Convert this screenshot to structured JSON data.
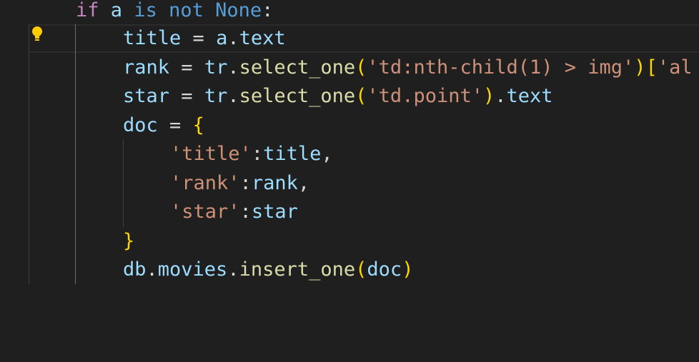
{
  "editor": {
    "language": "python",
    "theme_background": "#1f1f1f",
    "active_line": 2,
    "lightbulb_icon": "lightbulb-icon"
  },
  "lines": [
    {
      "tokens": [
        {
          "t": "if",
          "c": "kw"
        },
        {
          "t": " ",
          "c": "op"
        },
        {
          "t": "a",
          "c": "var"
        },
        {
          "t": " ",
          "c": "op"
        },
        {
          "t": "is",
          "c": "kwb"
        },
        {
          "t": " ",
          "c": "op"
        },
        {
          "t": "not",
          "c": "kwb"
        },
        {
          "t": " ",
          "c": "op"
        },
        {
          "t": "None",
          "c": "cst"
        },
        {
          "t": ":",
          "c": "op"
        }
      ]
    },
    {
      "tokens": [
        {
          "t": "title",
          "c": "var"
        },
        {
          "t": " = ",
          "c": "op"
        },
        {
          "t": "a",
          "c": "var"
        },
        {
          "t": ".",
          "c": "op"
        },
        {
          "t": "text",
          "c": "var"
        }
      ]
    },
    {
      "tokens": [
        {
          "t": "rank",
          "c": "var"
        },
        {
          "t": " = ",
          "c": "op"
        },
        {
          "t": "tr",
          "c": "var"
        },
        {
          "t": ".",
          "c": "op"
        },
        {
          "t": "select_one",
          "c": "fn"
        },
        {
          "t": "(",
          "c": "br1"
        },
        {
          "t": "'td:nth-child(1) > img'",
          "c": "str"
        },
        {
          "t": ")",
          "c": "br1"
        },
        {
          "t": "[",
          "c": "br1"
        },
        {
          "t": "'al",
          "c": "str"
        }
      ]
    },
    {
      "tokens": [
        {
          "t": "star",
          "c": "var"
        },
        {
          "t": " = ",
          "c": "op"
        },
        {
          "t": "tr",
          "c": "var"
        },
        {
          "t": ".",
          "c": "op"
        },
        {
          "t": "select_one",
          "c": "fn"
        },
        {
          "t": "(",
          "c": "br1"
        },
        {
          "t": "'td.point'",
          "c": "str"
        },
        {
          "t": ")",
          "c": "br1"
        },
        {
          "t": ".",
          "c": "op"
        },
        {
          "t": "text",
          "c": "var"
        }
      ]
    },
    {
      "tokens": [
        {
          "t": "doc",
          "c": "var"
        },
        {
          "t": " = ",
          "c": "op"
        },
        {
          "t": "{",
          "c": "br1"
        }
      ]
    },
    {
      "tokens": [
        {
          "t": "'title'",
          "c": "str"
        },
        {
          "t": ":",
          "c": "op"
        },
        {
          "t": "title",
          "c": "var"
        },
        {
          "t": ",",
          "c": "op"
        }
      ]
    },
    {
      "tokens": [
        {
          "t": "'rank'",
          "c": "str"
        },
        {
          "t": ":",
          "c": "op"
        },
        {
          "t": "rank",
          "c": "var"
        },
        {
          "t": ",",
          "c": "op"
        }
      ]
    },
    {
      "tokens": [
        {
          "t": "'star'",
          "c": "str"
        },
        {
          "t": ":",
          "c": "op"
        },
        {
          "t": "star",
          "c": "var"
        }
      ]
    },
    {
      "tokens": [
        {
          "t": "}",
          "c": "br1"
        }
      ]
    },
    {
      "tokens": [
        {
          "t": "db",
          "c": "var"
        },
        {
          "t": ".",
          "c": "op"
        },
        {
          "t": "movies",
          "c": "var"
        },
        {
          "t": ".",
          "c": "op"
        },
        {
          "t": "insert_one",
          "c": "fn"
        },
        {
          "t": "(",
          "c": "br1"
        },
        {
          "t": "doc",
          "c": "var"
        },
        {
          "t": ")",
          "c": "br1"
        }
      ]
    }
  ]
}
